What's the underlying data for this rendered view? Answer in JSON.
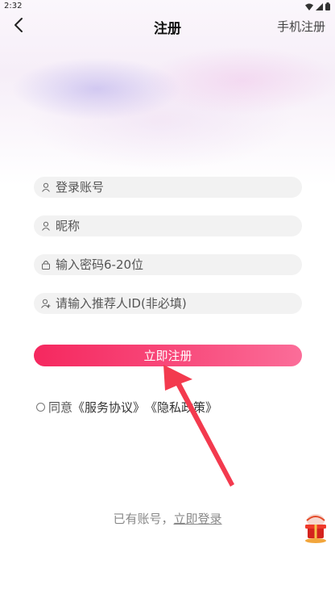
{
  "status_bar": {
    "time": "2:32"
  },
  "nav": {
    "title": "注册",
    "right_action": "手机注册",
    "back_icon": "chevron-left-icon"
  },
  "form": {
    "account_placeholder": "登录账号",
    "nickname_placeholder": "昵称",
    "password_placeholder": "输入密码6-20位",
    "referrer_placeholder": "请输入推荐人ID(非必填)",
    "submit_label": "立即注册"
  },
  "agreement": {
    "prefix": "同意",
    "terms_link": "《服务协议》",
    "privacy_link": "《隐私政策》",
    "checked": false
  },
  "footer": {
    "prompt": "已有账号，",
    "login_link": "立即登录"
  },
  "colors": {
    "accent_start": "#f5285f",
    "accent_end": "#fb6d99",
    "arrow": "#f33a4e"
  }
}
